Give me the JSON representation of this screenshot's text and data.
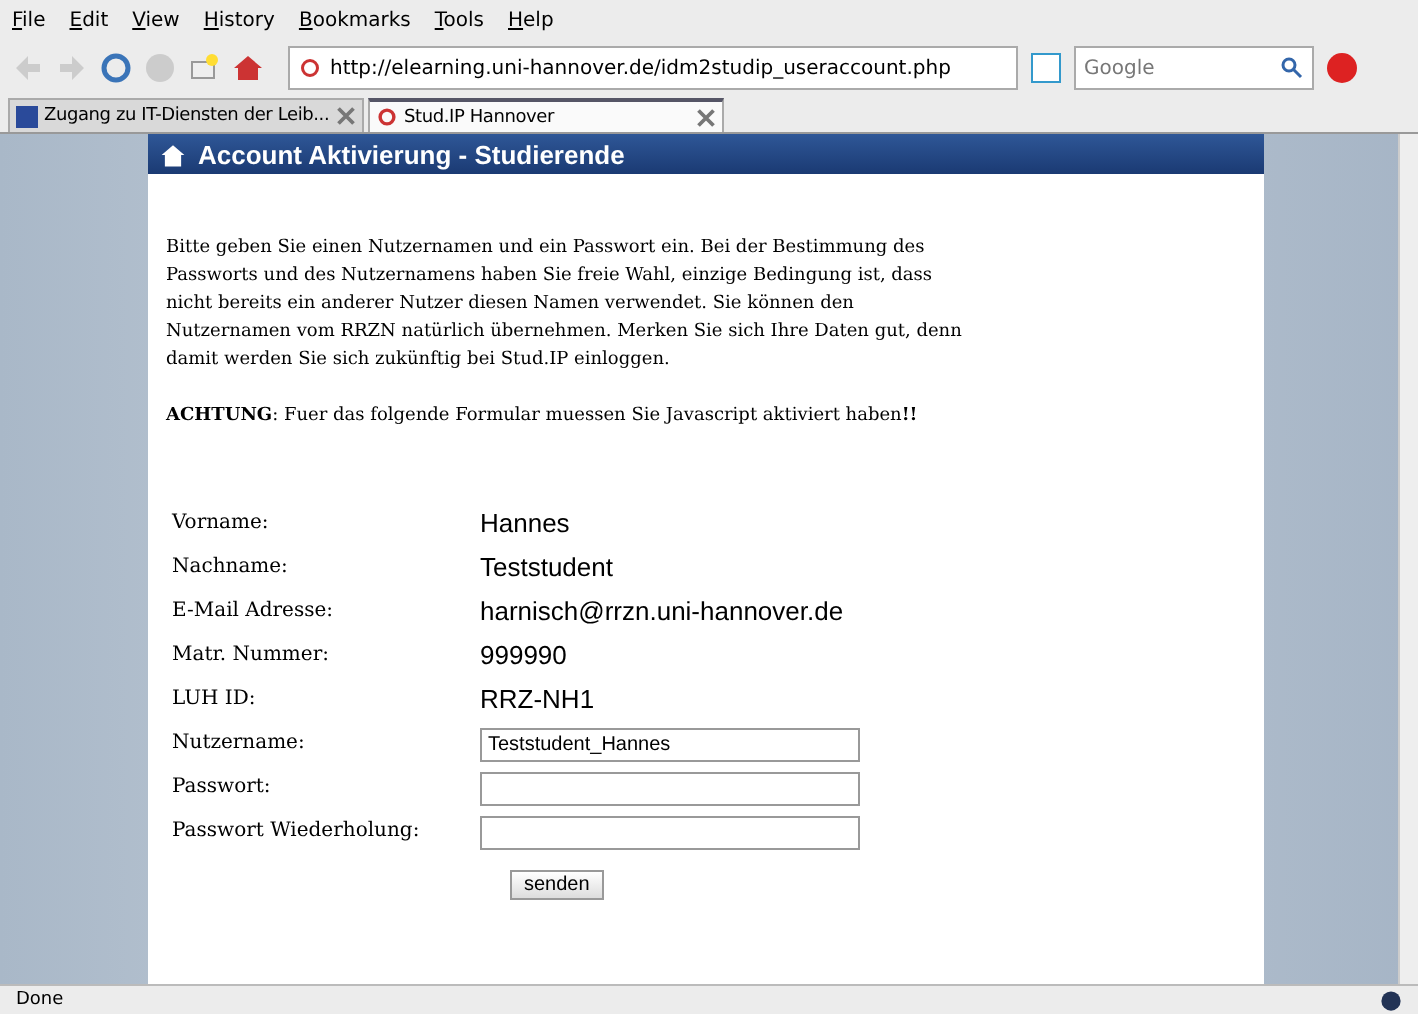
{
  "menu": [
    "File",
    "Edit",
    "View",
    "History",
    "Bookmarks",
    "Tools",
    "Help"
  ],
  "toolbar": {
    "url": "http://elearning.uni-hannover.de/idm2studip_useraccount.php",
    "search_placeholder": "Google"
  },
  "tabs": [
    {
      "label": "Zugang zu IT-Diensten der Leib...",
      "selected": false
    },
    {
      "label": "Stud.IP Hannover",
      "selected": true
    }
  ],
  "page": {
    "title": "Account Aktivierung - Studierende",
    "intro": "Bitte geben Sie einen Nutzernamen und ein Passwort ein. Bei der Bestimmung des Passworts und des Nutzernamens haben Sie freie Wahl, einzige Bedingung ist, dass nicht bereits ein anderer Nutzer diesen Namen verwendet. Sie können den Nutzernamen vom RRZN natürlich übernehmen. Merken Sie sich Ihre Daten gut, denn damit werden Sie sich zukünftig bei Stud.IP einloggen.",
    "warning": "**ACHTUNG**: Fuer das folgende Formular muessen Sie Javascript aktiviert haben**!!**",
    "fields": [
      {
        "label": "Vorname:",
        "kind": "text",
        "value": "Hannes"
      },
      {
        "label": "Nachname:",
        "kind": "text",
        "value": "Teststudent"
      },
      {
        "label": "E-Mail Adresse:",
        "kind": "text",
        "value": "harnisch@rrzn.uni-hannover.de"
      },
      {
        "label": "Matr. Nummer:",
        "kind": "text",
        "value": "999990"
      },
      {
        "label": "LUH ID:",
        "kind": "text",
        "value": "RRZ-NH1"
      },
      {
        "label": "Nutzername:",
        "kind": "input",
        "value": "Teststudent_Hannes"
      },
      {
        "label": "Passwort:",
        "kind": "input"
      },
      {
        "label": "Passwort Wiederholung:",
        "kind": "input"
      }
    ],
    "submit": "senden"
  },
  "status": "Done"
}
